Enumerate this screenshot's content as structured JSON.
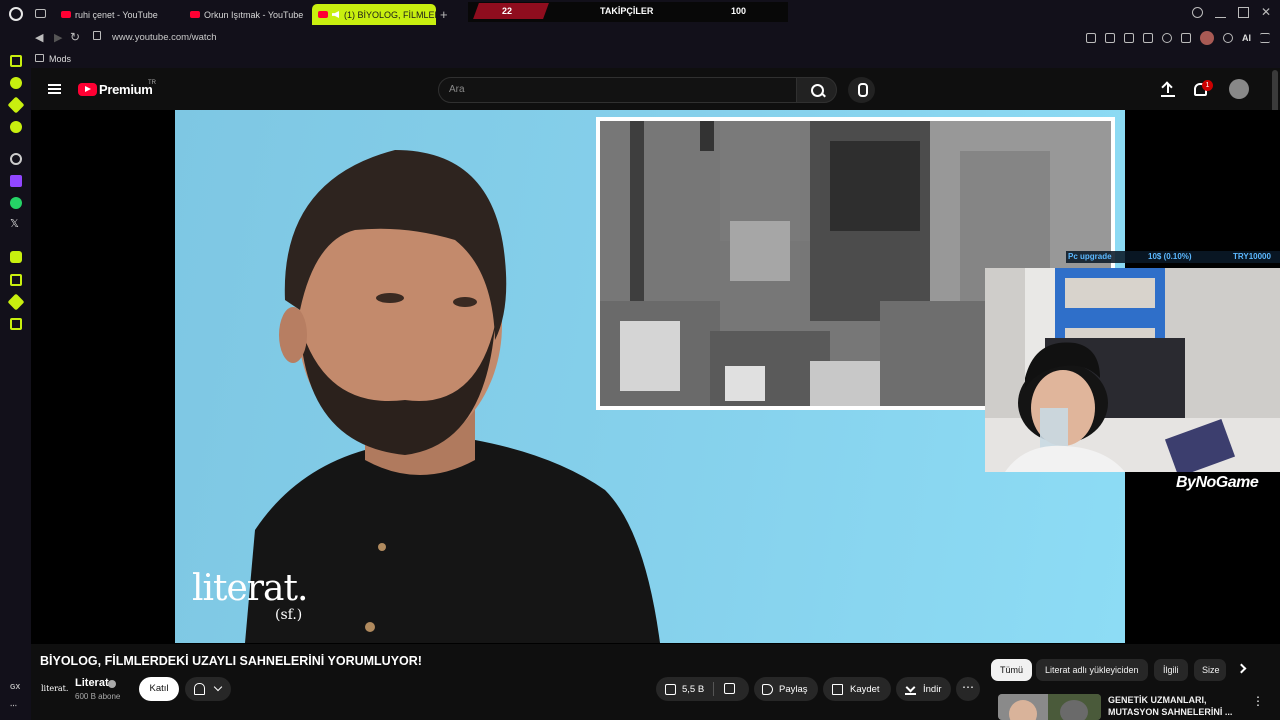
{
  "browser": {
    "tabs": [
      {
        "label": "ruhi çenet - YouTube"
      },
      {
        "label": "Orkun Işıtmak - YouTube"
      },
      {
        "label": "(1) BİYOLOG, FİLMLERİ..."
      }
    ],
    "url": "www.youtube.com/watch",
    "bookmark": "Mods",
    "ai_label": "AI",
    "sidebar_label": "GX"
  },
  "stream_overlay": {
    "left_count": "22",
    "label": "TAKİPÇİLER",
    "goal": "100"
  },
  "youtube": {
    "brand": "Premium",
    "region": "TR",
    "search_placeholder": "Ara",
    "notifications": "1"
  },
  "video": {
    "logo_main": "literat.",
    "logo_sub": "(sf.)",
    "title": "BİYOLOG, FİLMLERDEKİ UZAYLI SAHNELERİNİ YORUMLUYOR!",
    "channel_logo": "literat.",
    "channel": "Literat",
    "subscribers": "600 B abone",
    "join": "Katıl",
    "likes": "5,5 B",
    "share": "Paylaş",
    "save": "Kaydet",
    "download": "İndir",
    "more": "⋯"
  },
  "webcam": {
    "goal_label": "Pc upgrade",
    "goal_progress": "10$ (0.10%)",
    "goal_target": "TRY10000",
    "sponsor": "ByNoGame"
  },
  "chips": [
    "Tümü",
    "Literat adlı yükleyiciden",
    "İlgili",
    "Size"
  ],
  "recommendation": {
    "title_line1": "GENETİK UZMANLARI,",
    "title_line2": "MUTASYON SAHNELERİNİ ..."
  },
  "colors": {
    "accent": "#c8ef0f",
    "brand_red": "#ff0033",
    "overlay_red": "#8f0d1e",
    "video_bg": "#86d1ec"
  }
}
